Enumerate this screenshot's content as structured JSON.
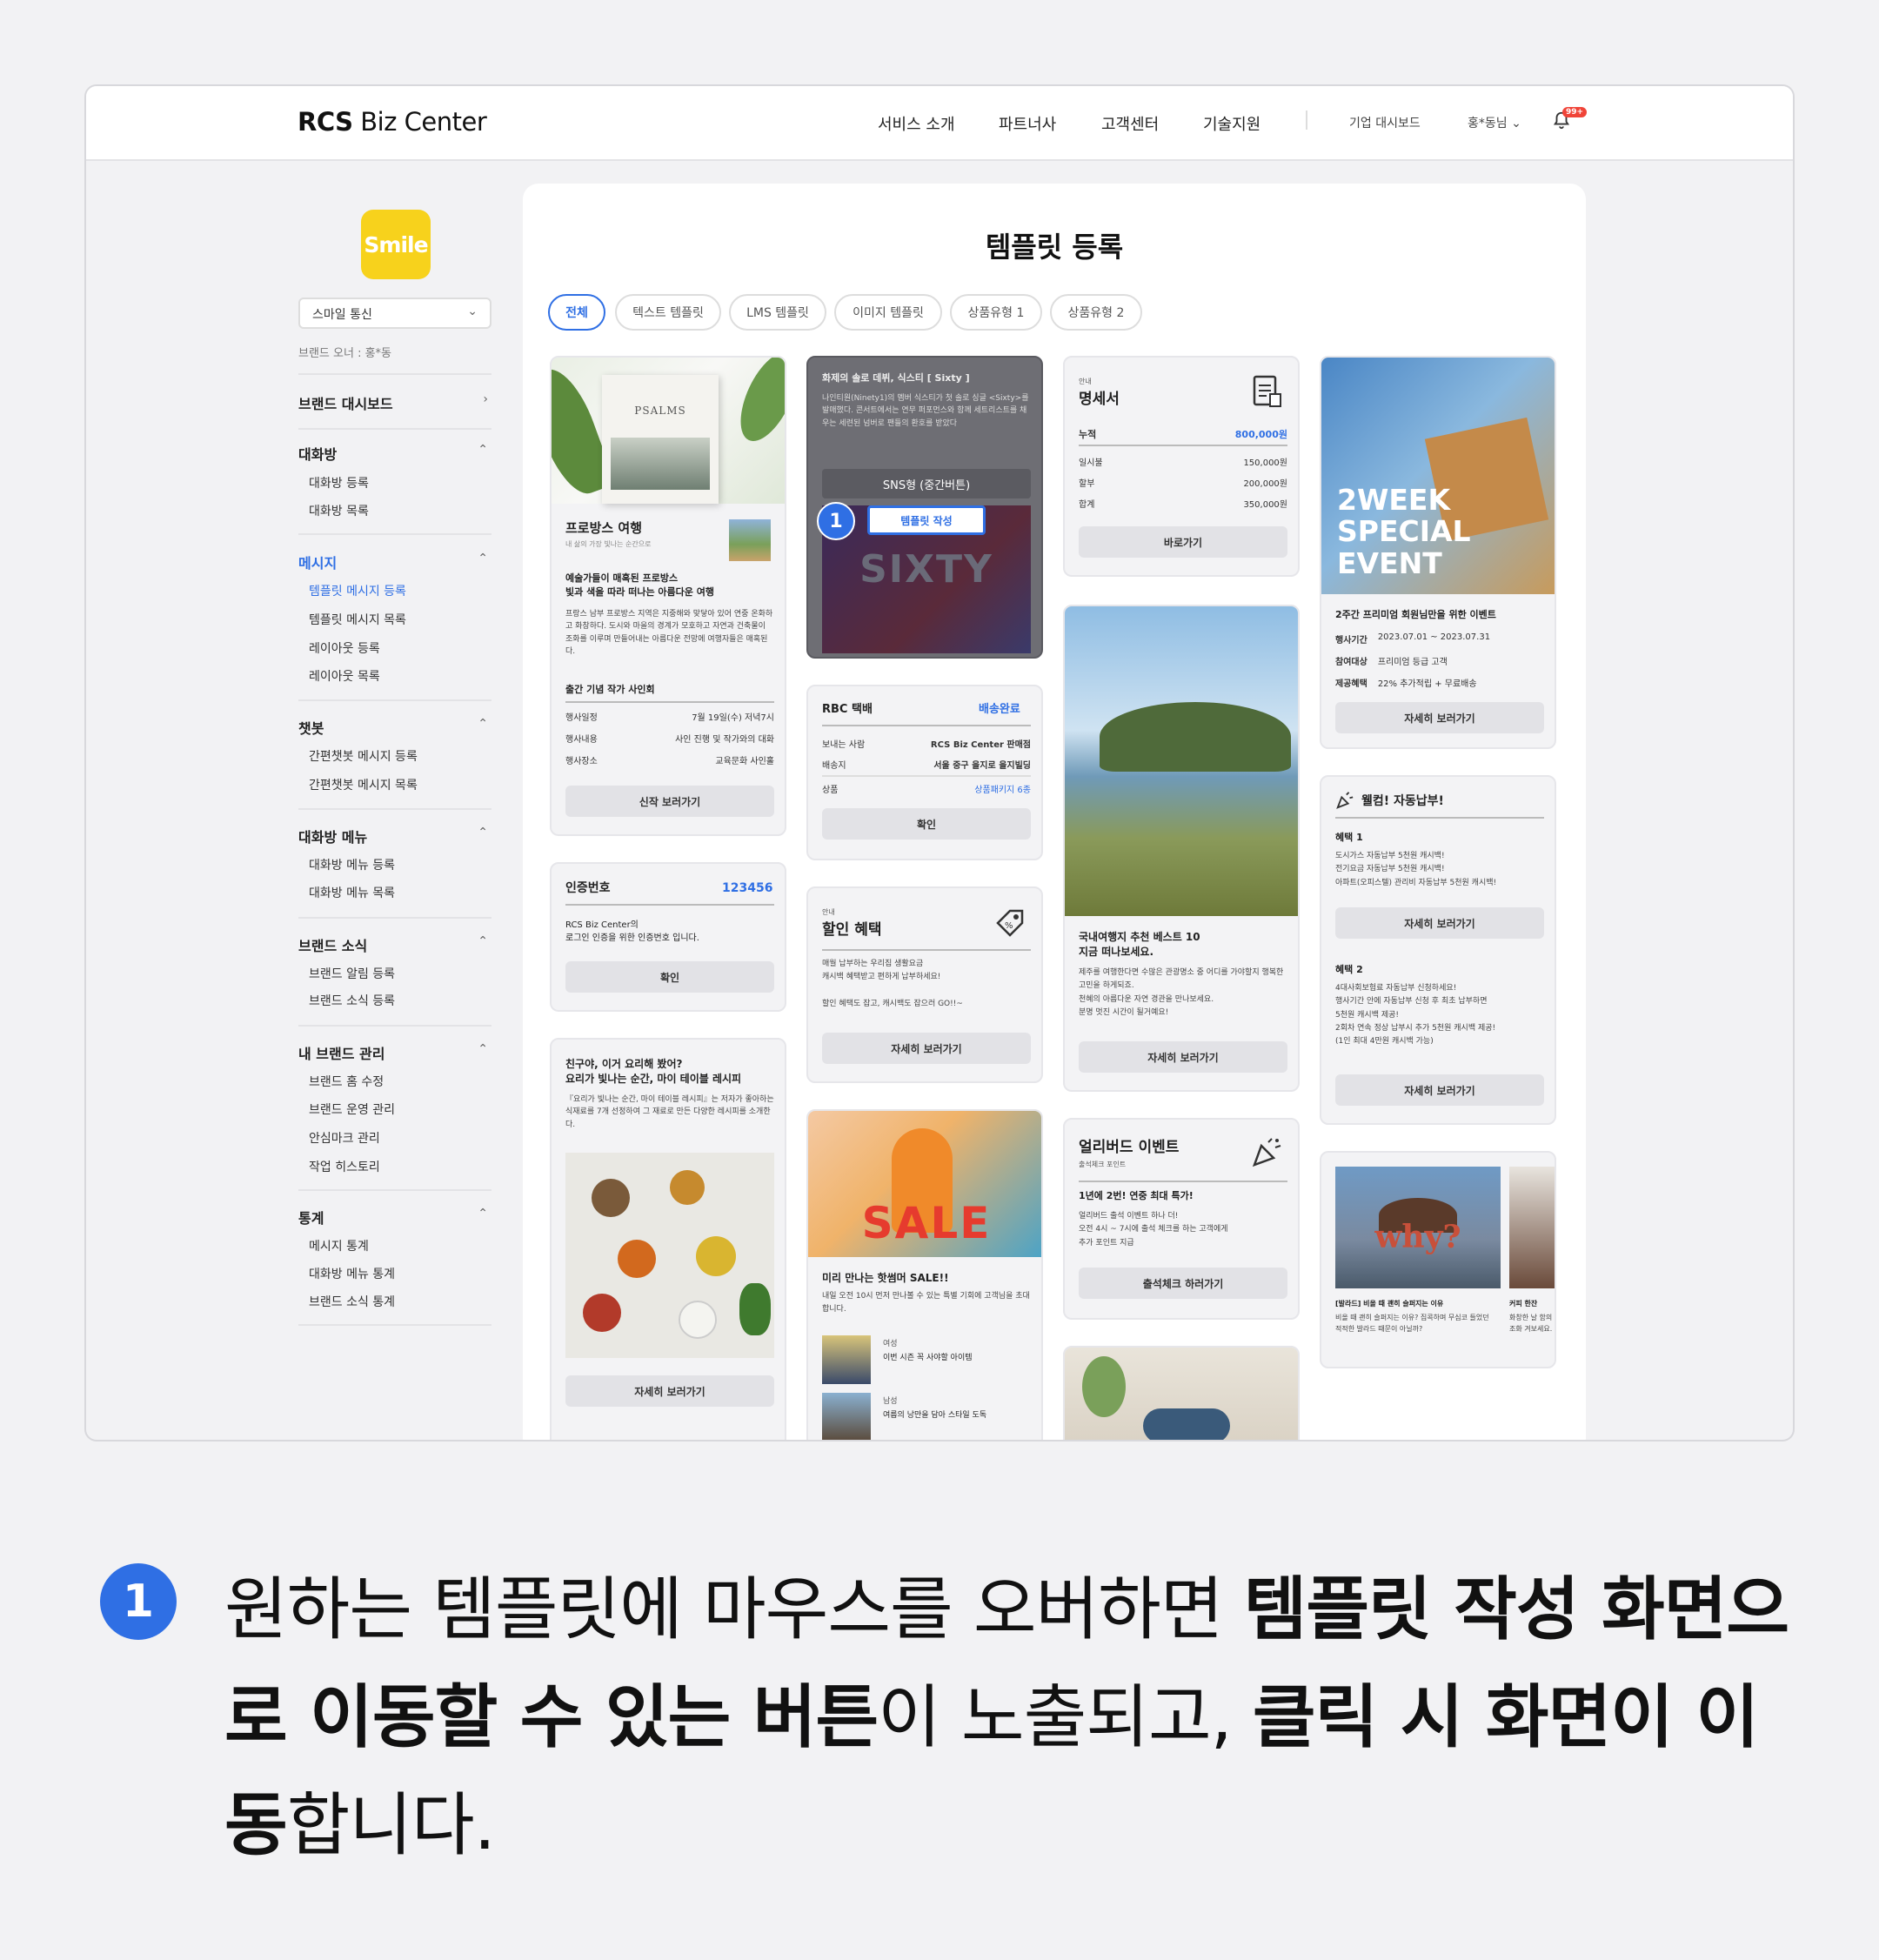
{
  "header": {
    "logo_bold": "RCS",
    "logo_rest": " Biz Center",
    "nav": [
      "서비스 소개",
      "파트너사",
      "고객센터",
      "기술지원"
    ],
    "dashboard": "기업 대시보드",
    "user": "홍*동님 ⌄",
    "badge": "99+"
  },
  "sidebar": {
    "brand_logo": "Smile",
    "brand_select": "스마일 통신",
    "owner": "브랜드 오너 : 홍*동",
    "dashboard": "브랜드 대시보드",
    "sections": [
      {
        "title": "대화방",
        "items": [
          "대화방 등록",
          "대화방 목록"
        ]
      },
      {
        "title": "메시지",
        "items": [
          "템플릿 메시지 등록",
          "템플릿 메시지 목록",
          "레이아웃 등록",
          "레이아웃 목록"
        ]
      },
      {
        "title": "챗봇",
        "items": [
          "간편챗봇 메시지 등록",
          "간편챗봇 메시지 목록"
        ]
      },
      {
        "title": "대화방 메뉴",
        "items": [
          "대화방 메뉴 등록",
          "대화방 메뉴 목록"
        ]
      },
      {
        "title": "브랜드 소식",
        "items": [
          "브랜드 알림 등록",
          "브랜드 소식 등록"
        ]
      },
      {
        "title": "내 브랜드 관리",
        "items": [
          "브랜드 홈 수정",
          "브랜드 운영 관리",
          "안심마크 관리",
          "작업 히스토리"
        ]
      },
      {
        "title": "통계",
        "items": [
          "메시지 통계",
          "대화방 메뉴 통계",
          "브랜드 소식 통계"
        ]
      }
    ]
  },
  "main": {
    "title": "템플릿 등록",
    "tabs": [
      "전체",
      "텍스트 템플릿",
      "LMS 템플릿",
      "이미지 템플릿",
      "상품유형 1",
      "상품유형 2"
    ],
    "c1": {
      "img_text": "PSALMS",
      "title": "프로방스 여행",
      "subtitle": "내 삶의 가장 빛나는 순간으로",
      "head": "예술가들이 매혹된 프로방스\n빛과 색을 따라 떠나는 아름다운 여행",
      "body": "프랑스 남부 프로방스 지역은 지중해와 맞닿아 있어 연중 온화하고 화창하다. 도시와 마을의 경계가 모호하고 자연과 건축물이 조화를 이루며 만들어내는 아름다운 전망에 여행자들은 매혹된다.",
      "event": "출간 기념 작가 사인회",
      "rows": [
        [
          "행사일정",
          "7월 19일(수) 저녁7시"
        ],
        [
          "행사내용",
          "사인 진행 및 작가와의 대화"
        ],
        [
          "행사장소",
          "교육문화 사인홀"
        ]
      ],
      "btn": "신작 보러가기"
    },
    "c2": {
      "title": "인증번호",
      "code": "123456",
      "body": "RCS Biz Center의\n로그인 인증을 위한 인증번호 입니다.",
      "btn": "확인"
    },
    "c3": {
      "head": "친구야, 이거 요리해 봤어?\n요리가 빛나는 순간, 마이 테이블 레시피",
      "body": "『요리가 빛나는 순간, 마이 테이블 레시피』는 저자가 좋아하는 식재료를 7개 선정하여 그 재료로 만든 다양한 레시피를 소개한다.",
      "btn": "자세히 보러가기"
    },
    "c4": {
      "head": "화제의 솔로 데뷔, 식스티 [ Sixty ]",
      "body": "나인티원(Ninety1)의 멤버 식스티가 첫 솔로 싱글 <Sixty>를 발매했다. 콘서트에서는 연무 퍼포먼스와 함께 세트리스트를 채우는 세련된 넘버로 팬들의 환호를 받았다",
      "overlay_label": "SNS형 (중간버튼)",
      "overlay_btn": "템플릿 작성",
      "img_text": "SIXTY",
      "marker": "1"
    },
    "c5": {
      "title": "RBC 택배",
      "status": "배송완료",
      "rows": [
        [
          "보내는 사람",
          "RCS Biz Center 판매점"
        ],
        [
          "배송지",
          "서울 중구 을지로 을지빌딩"
        ],
        [
          "상품",
          "상품패키지 6종"
        ]
      ],
      "btn": "확인"
    },
    "c6": {
      "small": "안내",
      "title": "할인 혜택",
      "body": "매월 납부하는 우리집 생활요금\n캐시백 혜택받고 편하게 납부하세요!\n\n할인 혜택도 잡고, 캐시백도 잡으러 GO!!~",
      "btn": "자세히 보러가기"
    },
    "c7": {
      "img_text": "SALE",
      "title": "미리 만나는 핫썸머 SALE!!",
      "body": "내일 오전 10시 먼저 만나볼 수 있는 특별 기회에 고객님을 초대합니다.",
      "items": [
        [
          "여성",
          "이번 시즌 꼭 사야할 아이템"
        ],
        [
          "남성",
          "여름의 낭만을 담아 스타일 도독"
        ]
      ]
    },
    "c8": {
      "small": "안내",
      "title": "명세서",
      "rows": [
        [
          "누적",
          "800,000원"
        ],
        [
          "일시불",
          "150,000원"
        ],
        [
          "할부",
          "200,000원"
        ],
        [
          "합계",
          "350,000원"
        ]
      ],
      "btn": "바로가기"
    },
    "c9": {
      "head": "국내여행지 추천 베스트 10\n지금 떠나보세요.",
      "body": "제주를 여행한다면 수많은 관광명소 중 어디를 가야할지 행복한 고민을 하게되죠.\n천혜의 아름다운 자연 경관을 만나보세요.\n분명 멋진 시간이 될거예요!",
      "btn": "자세히 보러가기"
    },
    "c10": {
      "title": "얼리버드 이벤트",
      "small": "출석체크 포인트",
      "head": "1년에 2번! 연중 최대 특가!",
      "body": "얼리버드 출석 이벤트 하나 더!\n오전 4시 ~ 7시에 출석 체크를 하는 고객에게\n추가 포인트 지급",
      "btn": "출석체크 하러가기"
    },
    "c11": {
      "img_text": "2WEEK\nSPECIAL\nEVENT",
      "head": "2주간 프리미엄 회원님만을 위한 이벤트",
      "rows": [
        [
          "행사기간",
          "2023.07.01 ~ 2023.07.31"
        ],
        [
          "참여대상",
          "프리미엄 등급 고객"
        ],
        [
          "제공혜택",
          "22% 추가적립 + 무료배송"
        ]
      ],
      "btn": "자세히 보러가기"
    },
    "c12": {
      "title": "웰컴! 자동납부!",
      "b1": "혜택 1",
      "b1_body": "도시가스 자동납부 5천원 캐시백!\n전기요금 자동납부 5천원 캐시백!\n아파트(오피스텔) 관리비 자동납부 5천원 캐시백!",
      "btn1": "자세히 보러가기",
      "b2": "혜택 2",
      "b2_body": "4대사회보험료 자동납부 신청하세요!\n행사기간 안에 자동납부 신청 후 최초 납부하면\n5천원 캐시백 제공!\n2회차 연속 정상 납부시 추가 5천원 캐시백 제공!\n(1인 최대 4만원 캐시백 가능)",
      "btn2": "자세히 보러가기"
    },
    "c13": {
      "img_text": "why?",
      "a_title": "[발라드] 비올 때 괜히 슬퍼지는 이유",
      "a_body": "비올 때 괜히 슬퍼지는 이유? 집콕하며 무심코 들었던 적적한 발라드 때문이 아닐까?",
      "b_title": "커피 한잔",
      "b_body": "화창한 날 함의 조화 겨보세요."
    }
  },
  "caption": {
    "num": "1",
    "p1": "원하는 템플릿에 마우스를 오버하면 ",
    "b1": "템플릿 작성 화면으로 이동할 수 있는 버튼",
    "p2": "이 노출되고, ",
    "b2": "클릭 시 화면이 이동",
    "p3": "합니다."
  }
}
